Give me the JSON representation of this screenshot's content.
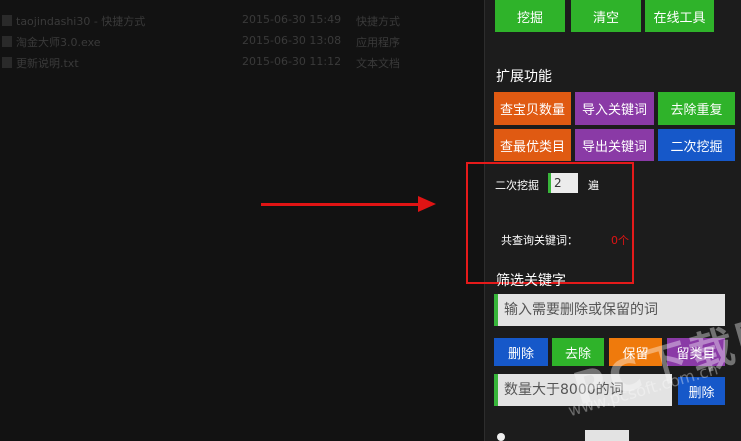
{
  "file_list": [
    {
      "name": "taojindashi30 - 快捷方式",
      "date": "2015-06-30 15:49",
      "type": "快捷方式"
    },
    {
      "name": "淘金大师3.0.exe",
      "date": "2015-06-30 13:08",
      "type": "应用程序"
    },
    {
      "name": "更新说明.txt",
      "date": "2015-06-30 11:12",
      "type": "文本文档"
    }
  ],
  "top_buttons": {
    "mine": "挖掘",
    "clear": "清空",
    "online_tools": "在线工具"
  },
  "extend": {
    "title": "扩展功能",
    "buttons": {
      "check_count": "查宝贝数量",
      "import_keywords": "导入关键词",
      "dedupe": "去除重复",
      "best_category": "查最优类目",
      "export_keywords": "导出关键词",
      "second_mine": "二次挖掘"
    }
  },
  "second_mining": {
    "label": "二次挖掘",
    "value": "2",
    "unit": "遍"
  },
  "query_total": {
    "label": "共查询关键词：",
    "value": "0个"
  },
  "filter": {
    "title": "筛选关键字",
    "placeholder": "输入需要删除或保留的词",
    "buttons": {
      "delete": "删除",
      "remove": "去除",
      "keep": "保留",
      "keep_category": "留类目"
    },
    "count_placeholder": "数量大于8000的词",
    "count_delete": "删除"
  },
  "watermark": {
    "main": "PC下载网",
    "sub": "www.pcsoft.com.cn"
  },
  "colors": {
    "green": "#2fb32a",
    "orange": "#e05a12",
    "purple": "#8a3aa6",
    "blue": "#1658c9",
    "annotation_red": "#e01414"
  }
}
